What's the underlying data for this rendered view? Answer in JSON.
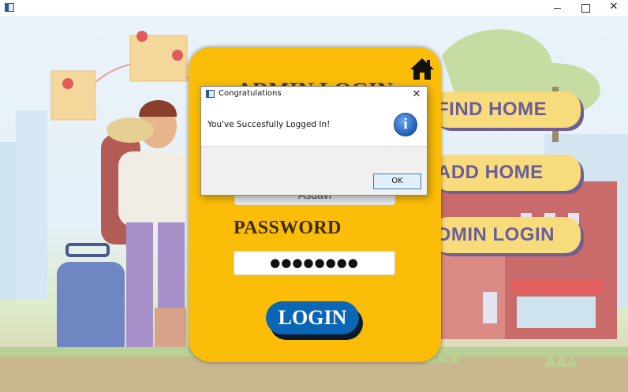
{
  "window": {
    "close_glyph": "✕"
  },
  "scene": {
    "menu": [
      {
        "label": "FIND HOME"
      },
      {
        "label": "ADD HOME"
      },
      {
        "label": "DMIN LOGIN"
      }
    ]
  },
  "login_card": {
    "title": "ADMIN LOGIN",
    "username_value": "Asdavi",
    "password_label": "PASSWORD",
    "password_value": "●●●●●●●●",
    "login_button": "LOGIN",
    "home_icon": "home-icon"
  },
  "dialog": {
    "title": "Congratulations",
    "message": "You've Succesfully Logged In!",
    "info_glyph": "i",
    "ok_button": "OK",
    "close_glyph": "✕"
  },
  "colors": {
    "card": "#fbbd08",
    "login_button": "#0b66b5",
    "menu_button": "#f8dc7c",
    "menu_text": "#6a5d9a"
  }
}
